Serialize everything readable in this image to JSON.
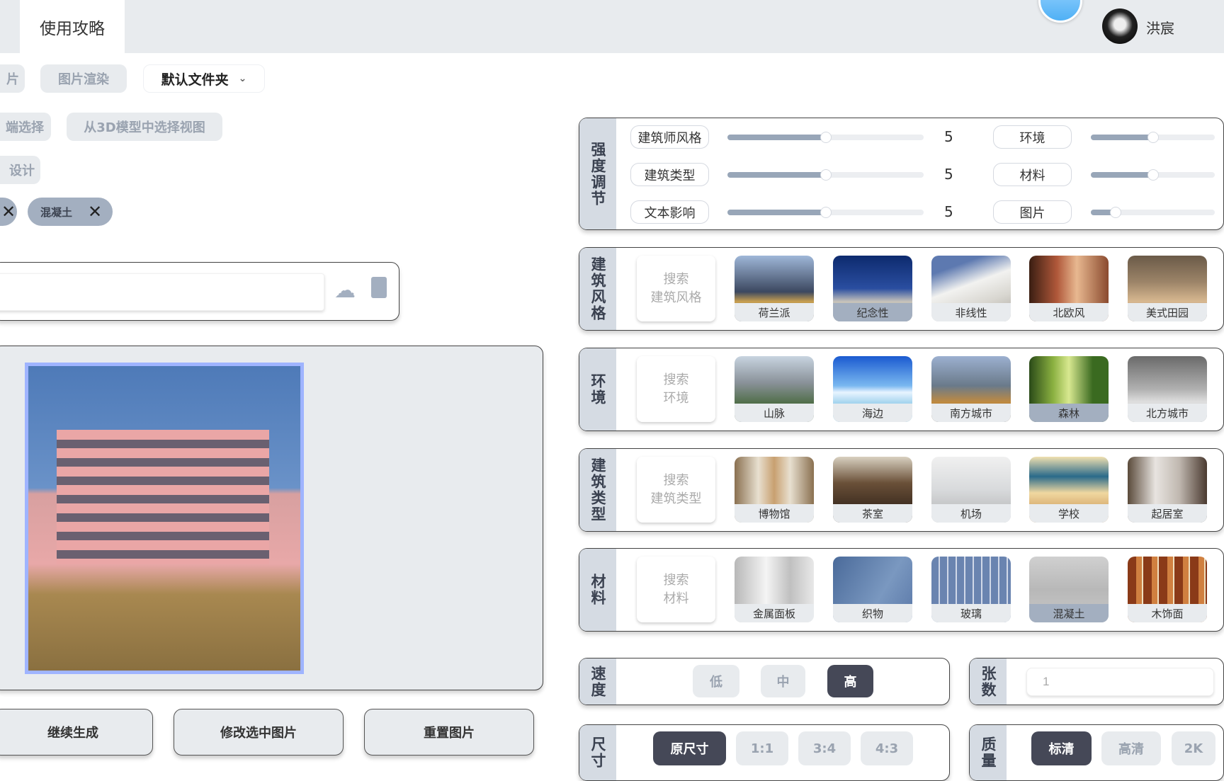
{
  "header": {
    "tab": "使用攻略",
    "user_name": "洪宸"
  },
  "toolbar": {
    "clipped_button_1": "片",
    "render_button": "图片渲染",
    "folder_dropdown": "默认文件夹",
    "clipped_button_2": "端选择",
    "select_from_3d": "从3D模型中选择视图",
    "clipped_button_3": "设计"
  },
  "tags": [
    {
      "label": "混凝土"
    }
  ],
  "prompt_input": {
    "value": ""
  },
  "actions": {
    "continue": "继续生成",
    "modify": "修改选中图片",
    "reset": "重置图片"
  },
  "intensity": {
    "title": "强度调节",
    "range": [
      0,
      10
    ],
    "rows": [
      {
        "label": "建筑师风格",
        "value": 5,
        "value_text": "5"
      },
      {
        "label": "建筑类型",
        "value": 5,
        "value_text": "5"
      },
      {
        "label": "文本影响",
        "value": 5,
        "value_text": "5"
      },
      {
        "label": "环境",
        "value": 5
      },
      {
        "label": "材料",
        "value": 5
      },
      {
        "label": "图片",
        "value": 2
      }
    ]
  },
  "galleries": [
    {
      "title": "建筑风格",
      "search": "搜索\n建筑风格",
      "items": [
        {
          "label": "荷兰派",
          "img": "linear-gradient(#9fb7d8,#3c4860 55%,#c9a050 70%,#3a3a40)"
        },
        {
          "label": "纪念性",
          "img": "linear-gradient(#0d2a6e,#2a4ea0 50%,#c8c4bb 70%,#8a8680)",
          "selected": true
        },
        {
          "label": "非线性",
          "img": "linear-gradient(160deg,#5d79b0 20%,#f2f2f0 45%,#d8d6d0 70%,#a8a49c)"
        },
        {
          "label": "北欧风",
          "img": "linear-gradient(90deg,#3a1e12,#b0583a 35%,#e8b890 60%,#8a4a2e)"
        },
        {
          "label": "美式田园",
          "img": "linear-gradient(#6a5a48,#9c8468 40%,#d8b890 70%,#5a4a38)"
        }
      ]
    },
    {
      "title": "环境",
      "search": "搜索\n环境",
      "items": [
        {
          "label": "山脉",
          "img": "linear-gradient(#c8d4e0,#8a929a 40%,#4a6a40 75%,#2e4a28)"
        },
        {
          "label": "海边",
          "img": "linear-gradient(#1a5ad0,#7ab8f0 45%,#e8f4ff 55%,#2a9ad0)"
        },
        {
          "label": "南方城市",
          "img": "linear-gradient(#9cb0d0,#6a7a8a 45%,#c08a40 70%,#3a3020)"
        },
        {
          "label": "森林",
          "img": "linear-gradient(90deg,#2a4a18,#8ab040 30%,#d8e890 50%,#3a6a20 80%)",
          "selected": true
        },
        {
          "label": "北方城市",
          "img": "linear-gradient(#6a6a6a,#b0b0b0 50%,#e0e0e0 70%,#707070)"
        }
      ]
    },
    {
      "title": "建筑类型",
      "search": "搜索\n建筑类型",
      "items": [
        {
          "label": "博物馆",
          "img": "linear-gradient(90deg,#8a7050,#e8e0d0 30%,#c8a070 50%,#e8e0d0 70%,#8a7050)"
        },
        {
          "label": "茶室",
          "img": "linear-gradient(#d8d0c0,#6a5038 40%,#3a2a1e 80%)"
        },
        {
          "label": "机场",
          "img": "linear-gradient(#f0f0f0,#d8dadc 50%,#b0b0b0)"
        },
        {
          "label": "学校",
          "img": "linear-gradient(#f0e0b0,#2a6a8a 30%,#f0d8a0 55%,#c08040)"
        },
        {
          "label": "起居室",
          "img": "linear-gradient(90deg,#5a4a3a,#e8e4e0 35%,#c0b8b0 65%,#4a3a30)"
        }
      ]
    },
    {
      "title": "材料",
      "search": "搜索\n材料",
      "items": [
        {
          "label": "金属面板",
          "img": "linear-gradient(90deg,#b8b8b8,#f4f4f4 40%,#c0c0c0 70%,#e8e8e8)"
        },
        {
          "label": "织物",
          "img": "linear-gradient(120deg,#4a6a9a,#7a98c0 60%,#5a78a8)"
        },
        {
          "label": "玻璃",
          "img": "repeating-linear-gradient(90deg,#6a84b0 0 10px,#d0d8e8 10px 12px)"
        },
        {
          "label": "混凝土",
          "img": "linear-gradient(#d0d0d0,#b8b8b8 50%,#c8c8c8)",
          "selected": true
        },
        {
          "label": "木饰面",
          "img": "repeating-linear-gradient(90deg,#8a3a18 0 12px,#d08040 12px 20px,#f0e0c0 20px 22px)"
        }
      ]
    }
  ],
  "speed": {
    "title": "速度",
    "options": [
      "低",
      "中",
      "高"
    ],
    "selected": "高"
  },
  "count": {
    "title": "张数",
    "value": "1"
  },
  "size": {
    "title": "尺寸",
    "options": [
      "原尺寸",
      "1:1",
      "3:4",
      "4:3"
    ],
    "selected": "原尺寸"
  },
  "quality": {
    "title": "质量",
    "options": [
      "标清",
      "高清",
      "2K"
    ],
    "selected": "标清"
  },
  "colors": {
    "accent_dark": "#454857",
    "selected_tile": "#a3afc0",
    "panel_bg": "#e8ebee"
  }
}
